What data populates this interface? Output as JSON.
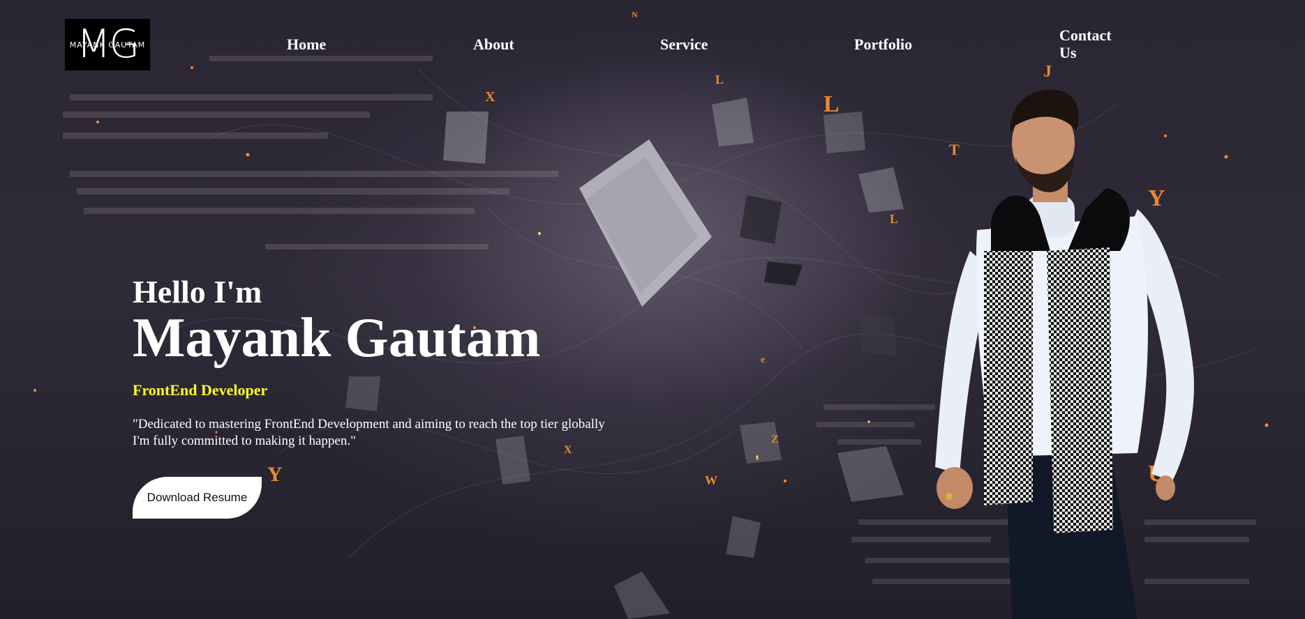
{
  "logo": {
    "mark": "MG",
    "name": "MAYANK GAUTAM"
  },
  "nav": {
    "home": "Home",
    "about": "About",
    "service": "Service",
    "portfolio": "Portfolio",
    "contact": "Contact Us"
  },
  "hero": {
    "greeting": "Hello I'm",
    "name": "Mayank Gautam",
    "role": "FrontEnd Developer",
    "tagline_line1": "\"Dedicated to mastering FrontEnd Development and aiming to reach the top tier globally",
    "tagline_line2": "I'm fully committed to making it happen.\"",
    "download_label": "Download Resume"
  },
  "colors": {
    "role": "#ffff2a",
    "logo_bg": "#000000",
    "button_bg": "#ffffff"
  }
}
